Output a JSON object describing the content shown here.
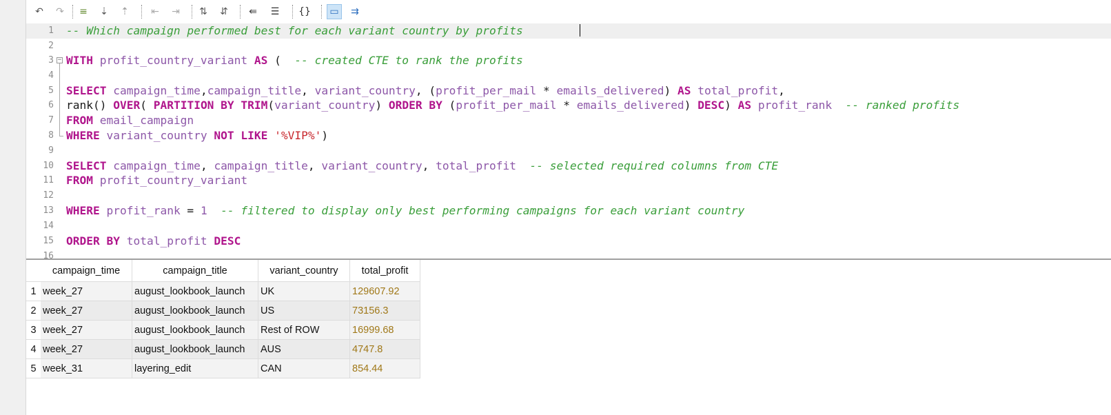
{
  "toolbar": {
    "buttons": [
      {
        "name": "undo-icon",
        "glyph": "↶"
      },
      {
        "name": "redo-icon",
        "glyph": "↷"
      },
      {
        "name": "insert-row-icon",
        "glyph": "≡"
      },
      {
        "name": "move-down-icon",
        "glyph": "⇣"
      },
      {
        "name": "move-up-icon",
        "glyph": "⇡"
      },
      {
        "name": "indent-left-icon",
        "glyph": "⇤"
      },
      {
        "name": "indent-right-icon",
        "glyph": "⇥"
      },
      {
        "name": "sort-ascending-icon",
        "glyph": "⇅"
      },
      {
        "name": "sort-descending-icon",
        "glyph": "⇵"
      },
      {
        "name": "outdent-icon",
        "glyph": "⇚"
      },
      {
        "name": "format-icon",
        "glyph": "☰"
      },
      {
        "name": "braces-icon",
        "glyph": "{}"
      },
      {
        "name": "comment-icon",
        "glyph": "▭"
      },
      {
        "name": "execute-icon",
        "glyph": "⇉"
      }
    ]
  },
  "editor": {
    "lines": [
      {
        "n": "1",
        "tokens": [
          {
            "t": "-- Which campaign performed best for each variant country by profits",
            "c": "cm"
          }
        ]
      },
      {
        "n": "2",
        "tokens": []
      },
      {
        "n": "3",
        "tokens": [
          {
            "t": "WITH",
            "c": "kw"
          },
          {
            "t": " "
          },
          {
            "t": "profit_country_variant",
            "c": "id"
          },
          {
            "t": " "
          },
          {
            "t": "AS",
            "c": "kw"
          },
          {
            "t": " (  "
          },
          {
            "t": "-- created CTE to rank the profits",
            "c": "cm"
          }
        ]
      },
      {
        "n": "4",
        "tokens": []
      },
      {
        "n": "5",
        "tokens": [
          {
            "t": "SELECT",
            "c": "kw"
          },
          {
            "t": " "
          },
          {
            "t": "campaign_time",
            "c": "id"
          },
          {
            "t": ","
          },
          {
            "t": "campaign_title",
            "c": "id"
          },
          {
            "t": ", "
          },
          {
            "t": "variant_country",
            "c": "id"
          },
          {
            "t": ", ("
          },
          {
            "t": "profit_per_mail",
            "c": "id"
          },
          {
            "t": " * "
          },
          {
            "t": "emails_delivered",
            "c": "id"
          },
          {
            "t": ") "
          },
          {
            "t": "AS",
            "c": "kw"
          },
          {
            "t": " "
          },
          {
            "t": "total_profit",
            "c": "id"
          },
          {
            "t": ","
          }
        ]
      },
      {
        "n": "6",
        "tokens": [
          {
            "t": "rank"
          },
          {
            "t": "() "
          },
          {
            "t": "OVER",
            "c": "kw"
          },
          {
            "t": "( "
          },
          {
            "t": "PARTITION BY",
            "c": "kw"
          },
          {
            "t": " "
          },
          {
            "t": "TRIM",
            "c": "kw"
          },
          {
            "t": "("
          },
          {
            "t": "variant_country",
            "c": "id"
          },
          {
            "t": ") "
          },
          {
            "t": "ORDER BY",
            "c": "kw"
          },
          {
            "t": " ("
          },
          {
            "t": "profit_per_mail",
            "c": "id"
          },
          {
            "t": " * "
          },
          {
            "t": "emails_delivered",
            "c": "id"
          },
          {
            "t": ") "
          },
          {
            "t": "DESC",
            "c": "kw"
          },
          {
            "t": ") "
          },
          {
            "t": "AS",
            "c": "kw"
          },
          {
            "t": " "
          },
          {
            "t": "profit_rank",
            "c": "id"
          },
          {
            "t": "  "
          },
          {
            "t": "-- ranked profits",
            "c": "cm"
          }
        ]
      },
      {
        "n": "7",
        "tokens": [
          {
            "t": "FROM",
            "c": "kw"
          },
          {
            "t": " "
          },
          {
            "t": "email_campaign",
            "c": "id"
          }
        ]
      },
      {
        "n": "8",
        "tokens": [
          {
            "t": "WHERE",
            "c": "kw"
          },
          {
            "t": " "
          },
          {
            "t": "variant_country",
            "c": "id"
          },
          {
            "t": " "
          },
          {
            "t": "NOT LIKE",
            "c": "kw"
          },
          {
            "t": " "
          },
          {
            "t": "'%VIP%'",
            "c": "st"
          },
          {
            "t": ")"
          }
        ]
      },
      {
        "n": "9",
        "tokens": []
      },
      {
        "n": "10",
        "tokens": [
          {
            "t": "SELECT",
            "c": "kw"
          },
          {
            "t": " "
          },
          {
            "t": "campaign_time",
            "c": "id"
          },
          {
            "t": ", "
          },
          {
            "t": "campaign_title",
            "c": "id"
          },
          {
            "t": ", "
          },
          {
            "t": "variant_country",
            "c": "id"
          },
          {
            "t": ", "
          },
          {
            "t": "total_profit",
            "c": "id"
          },
          {
            "t": "  "
          },
          {
            "t": "-- selected required columns from CTE",
            "c": "cm"
          }
        ]
      },
      {
        "n": "11",
        "tokens": [
          {
            "t": "FROM",
            "c": "kw"
          },
          {
            "t": " "
          },
          {
            "t": "profit_country_variant",
            "c": "id"
          }
        ]
      },
      {
        "n": "12",
        "tokens": []
      },
      {
        "n": "13",
        "tokens": [
          {
            "t": "WHERE",
            "c": "kw"
          },
          {
            "t": " "
          },
          {
            "t": "profit_rank",
            "c": "id"
          },
          {
            "t": " = "
          },
          {
            "t": "1",
            "c": "nm"
          },
          {
            "t": "  "
          },
          {
            "t": "-- filtered to display only best performing campaigns for each variant country",
            "c": "cm"
          }
        ]
      },
      {
        "n": "14",
        "tokens": []
      },
      {
        "n": "15",
        "tokens": [
          {
            "t": "ORDER BY",
            "c": "kw"
          },
          {
            "t": " "
          },
          {
            "t": "total_profit",
            "c": "id"
          },
          {
            "t": " "
          },
          {
            "t": "DESC",
            "c": "kw"
          }
        ]
      },
      {
        "n": "16",
        "tokens": []
      }
    ]
  },
  "results": {
    "columns": [
      "campaign_time",
      "campaign_title",
      "variant_country",
      "total_profit"
    ],
    "rows": [
      {
        "num": "1",
        "cells": [
          "week_27",
          "august_lookbook_launch",
          "UK",
          "129607.92"
        ]
      },
      {
        "num": "2",
        "cells": [
          "week_27",
          "august_lookbook_launch",
          "US",
          "73156.3"
        ]
      },
      {
        "num": "3",
        "cells": [
          "week_27",
          "august_lookbook_launch",
          "Rest of ROW",
          "16999.68"
        ]
      },
      {
        "num": "4",
        "cells": [
          "week_27",
          "august_lookbook_launch",
          "AUS",
          "4747.8"
        ]
      },
      {
        "num": "5",
        "cells": [
          "week_31",
          "layering_edit",
          "CAN",
          "854.44"
        ]
      }
    ]
  }
}
